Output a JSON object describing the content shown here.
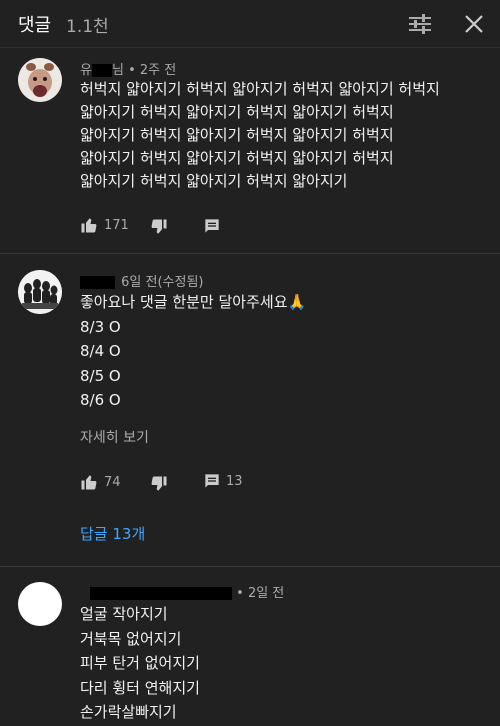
{
  "header": {
    "title": "댓글",
    "count": "1.1천"
  },
  "comments": [
    {
      "author_visible": "유",
      "author_suffix": "님",
      "meta_tail": " • 2주 전",
      "text": "허벅지 얇아지기 허벅지 얇아지기 허벅지 얇아지기 허벅지\n얇아지기 허벅지 얇아지기 허벅지 얇아지기 허벅지\n얇아지기 허벅지 얇아지기 허벅지 얇아지기 허벅지\n얇아지기 허벅지 얇아지기 허벅지 얇아지기 허벅지\n얇아지기 허벅지 얇아지기 허벅지 얇아지기",
      "likes": "171"
    },
    {
      "meta_tail": "6일 전(수정됨)",
      "text": "좋아요나 댓글 한분만 달아주세요🙏\n8/3 O\n8/4 O\n8/5 O\n8/6 O",
      "more": "자세히 보기",
      "likes": "74",
      "reply_count": "13",
      "replies_label": "답글 13개"
    },
    {
      "meta_tail": " • 2일 전",
      "text": "얼굴 작아지기\n거북목 없어지기\n피부 탄거 없어지기\n다리 휭터 연해지기\n손가락살빠지기"
    }
  ]
}
